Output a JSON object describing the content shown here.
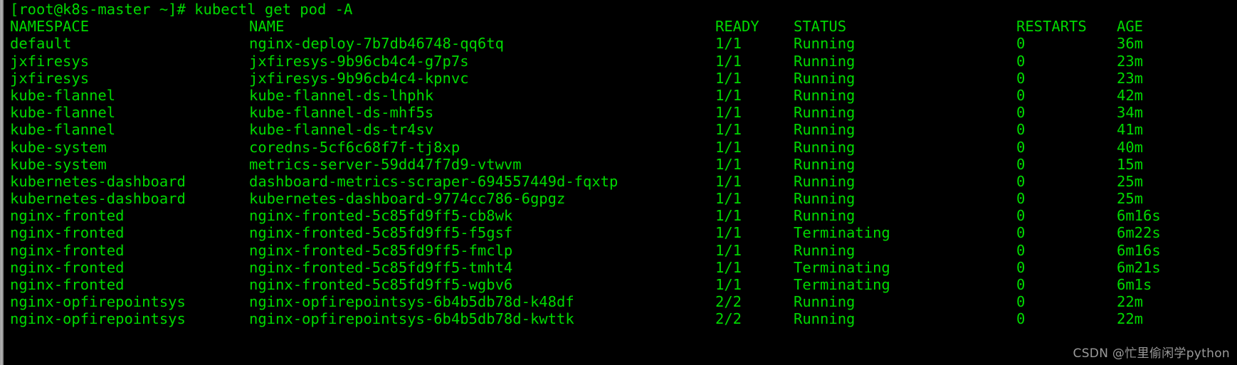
{
  "terminal": {
    "shell_prompt": "[root@k8s-master ~]# ",
    "command": "kubectl get pod -A",
    "prompt_full": "[root@k8s-master ~]# kubectl get pod -A",
    "text_color": "#00d900",
    "background_color": "#000000",
    "watermark": "CSDN @忙里偷闲学python"
  },
  "table": {
    "headers": {
      "namespace": "NAMESPACE",
      "name": "NAME",
      "ready": "READY",
      "status": "STATUS",
      "restarts": "RESTARTS",
      "age": "AGE"
    },
    "rows": [
      {
        "namespace": "default",
        "name": "nginx-deploy-7b7db46748-qq6tq",
        "ready": "1/1",
        "status": "Running",
        "restarts": "0",
        "age": "36m"
      },
      {
        "namespace": "jxfiresys",
        "name": "jxfiresys-9b96cb4c4-g7p7s",
        "ready": "1/1",
        "status": "Running",
        "restarts": "0",
        "age": "23m"
      },
      {
        "namespace": "jxfiresys",
        "name": "jxfiresys-9b96cb4c4-kpnvc",
        "ready": "1/1",
        "status": "Running",
        "restarts": "0",
        "age": "23m"
      },
      {
        "namespace": "kube-flannel",
        "name": "kube-flannel-ds-lhphk",
        "ready": "1/1",
        "status": "Running",
        "restarts": "0",
        "age": "42m"
      },
      {
        "namespace": "kube-flannel",
        "name": "kube-flannel-ds-mhf5s",
        "ready": "1/1",
        "status": "Running",
        "restarts": "0",
        "age": "34m"
      },
      {
        "namespace": "kube-flannel",
        "name": "kube-flannel-ds-tr4sv",
        "ready": "1/1",
        "status": "Running",
        "restarts": "0",
        "age": "41m"
      },
      {
        "namespace": "kube-system",
        "name": "coredns-5cf6c68f7f-tj8xp",
        "ready": "1/1",
        "status": "Running",
        "restarts": "0",
        "age": "40m"
      },
      {
        "namespace": "kube-system",
        "name": "metrics-server-59dd47f7d9-vtwvm",
        "ready": "1/1",
        "status": "Running",
        "restarts": "0",
        "age": "15m"
      },
      {
        "namespace": "kubernetes-dashboard",
        "name": "dashboard-metrics-scraper-694557449d-fqxtp",
        "ready": "1/1",
        "status": "Running",
        "restarts": "0",
        "age": "25m"
      },
      {
        "namespace": "kubernetes-dashboard",
        "name": "kubernetes-dashboard-9774cc786-6gpgz",
        "ready": "1/1",
        "status": "Running",
        "restarts": "0",
        "age": "25m"
      },
      {
        "namespace": "nginx-fronted",
        "name": "nginx-fronted-5c85fd9ff5-cb8wk",
        "ready": "1/1",
        "status": "Running",
        "restarts": "0",
        "age": "6m16s"
      },
      {
        "namespace": "nginx-fronted",
        "name": "nginx-fronted-5c85fd9ff5-f5gsf",
        "ready": "1/1",
        "status": "Terminating",
        "restarts": "0",
        "age": "6m22s"
      },
      {
        "namespace": "nginx-fronted",
        "name": "nginx-fronted-5c85fd9ff5-fmclp",
        "ready": "1/1",
        "status": "Running",
        "restarts": "0",
        "age": "6m16s"
      },
      {
        "namespace": "nginx-fronted",
        "name": "nginx-fronted-5c85fd9ff5-tmht4",
        "ready": "1/1",
        "status": "Terminating",
        "restarts": "0",
        "age": "6m21s"
      },
      {
        "namespace": "nginx-fronted",
        "name": "nginx-fronted-5c85fd9ff5-wgbv6",
        "ready": "1/1",
        "status": "Terminating",
        "restarts": "0",
        "age": "6m1s"
      },
      {
        "namespace": "nginx-opfirepointsys",
        "name": "nginx-opfirepointsys-6b4b5db78d-k48df",
        "ready": "2/2",
        "status": "Running",
        "restarts": "0",
        "age": "22m"
      },
      {
        "namespace": "nginx-opfirepointsys",
        "name": "nginx-opfirepointsys-6b4b5db78d-kwttk",
        "ready": "2/2",
        "status": "Running",
        "restarts": "0",
        "age": "22m"
      }
    ]
  }
}
